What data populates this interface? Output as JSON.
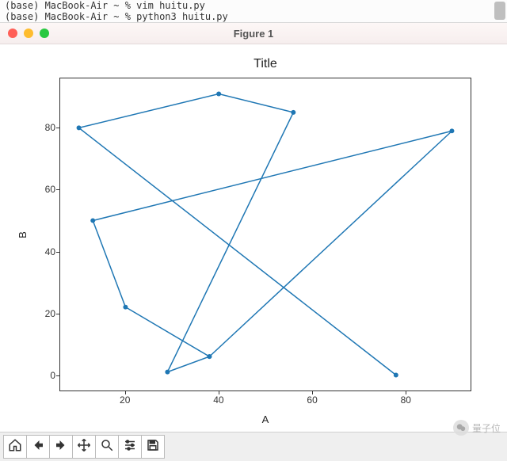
{
  "terminal": {
    "line0": "(base)            MacBook-Air ~ % vim huitu.py",
    "line1": "(base)            MacBook-Air ~ % python3 huitu.py"
  },
  "window": {
    "title": "Figure 1"
  },
  "chart_data": {
    "type": "line",
    "title": "Title",
    "xlabel": "A",
    "ylabel": "B",
    "x": [
      78,
      10,
      40,
      56,
      29,
      38,
      90,
      13,
      20,
      38
    ],
    "y": [
      0,
      80,
      91,
      85,
      1,
      6,
      79,
      50,
      22,
      6
    ],
    "xticks": [
      20,
      40,
      60,
      80
    ],
    "yticks": [
      0,
      20,
      40,
      60,
      80
    ],
    "xlim": [
      6,
      94
    ],
    "ylim": [
      -5,
      96
    ],
    "line_color": "#1f77b4",
    "markers": true
  },
  "toolbar": {
    "home": "Home",
    "back": "Back",
    "forward": "Forward",
    "pan": "Pan",
    "zoom": "Zoom",
    "configure": "Configure subplots",
    "save": "Save figure"
  },
  "watermark": {
    "text": "量子位"
  }
}
